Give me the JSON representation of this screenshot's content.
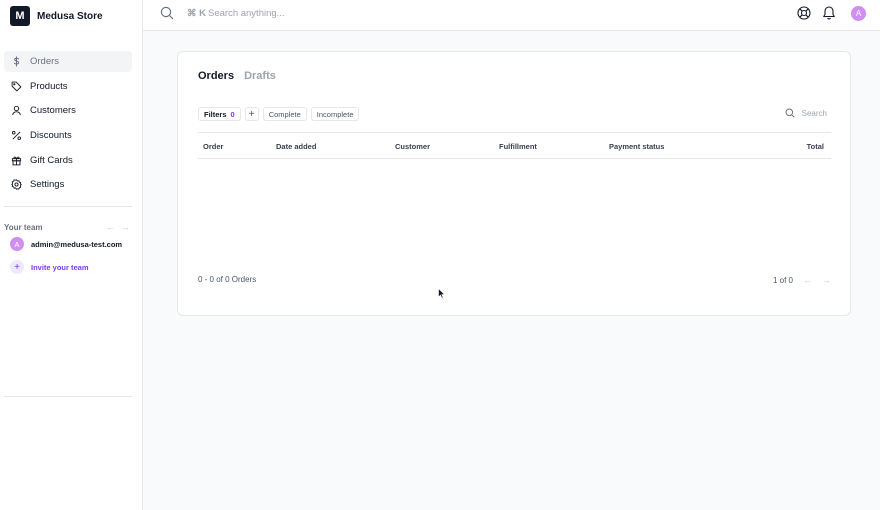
{
  "store": {
    "logo_letter": "M",
    "name": "Medusa Store"
  },
  "sidebar": {
    "items": [
      {
        "label": "Orders",
        "icon": "dollar-icon",
        "active": true
      },
      {
        "label": "Products",
        "icon": "tag-icon"
      },
      {
        "label": "Customers",
        "icon": "user-icon"
      },
      {
        "label": "Discounts",
        "icon": "percent-icon"
      },
      {
        "label": "Gift Cards",
        "icon": "gift-icon"
      },
      {
        "label": "Settings",
        "icon": "gear-icon"
      }
    ],
    "team": {
      "title": "Your team",
      "member": {
        "avatar": "A",
        "email": "admin@medusa-test.com"
      },
      "invite_label": "Invite your team"
    }
  },
  "topbar": {
    "shortcut": "⌘ K",
    "search_placeholder": "Search anything...",
    "avatar": "A"
  },
  "main": {
    "tabs": [
      {
        "label": "Orders",
        "active": true
      },
      {
        "label": "Drafts",
        "active": false
      }
    ],
    "filters": {
      "label": "Filters",
      "count": "0",
      "add": "+",
      "quick": [
        "Complete",
        "Incomplete"
      ]
    },
    "table_search_placeholder": "Search",
    "columns": [
      "Order",
      "Date added",
      "Customer",
      "Fulfillment",
      "Payment status",
      "Total"
    ],
    "rows": [],
    "pagination": {
      "summary": "0 - 0 of 0 Orders",
      "page": "1 of 0"
    }
  },
  "colors": {
    "accent": "#7c3aed",
    "avatar": "#d08ff0",
    "active_nav_bg": "#f3f4f6"
  }
}
